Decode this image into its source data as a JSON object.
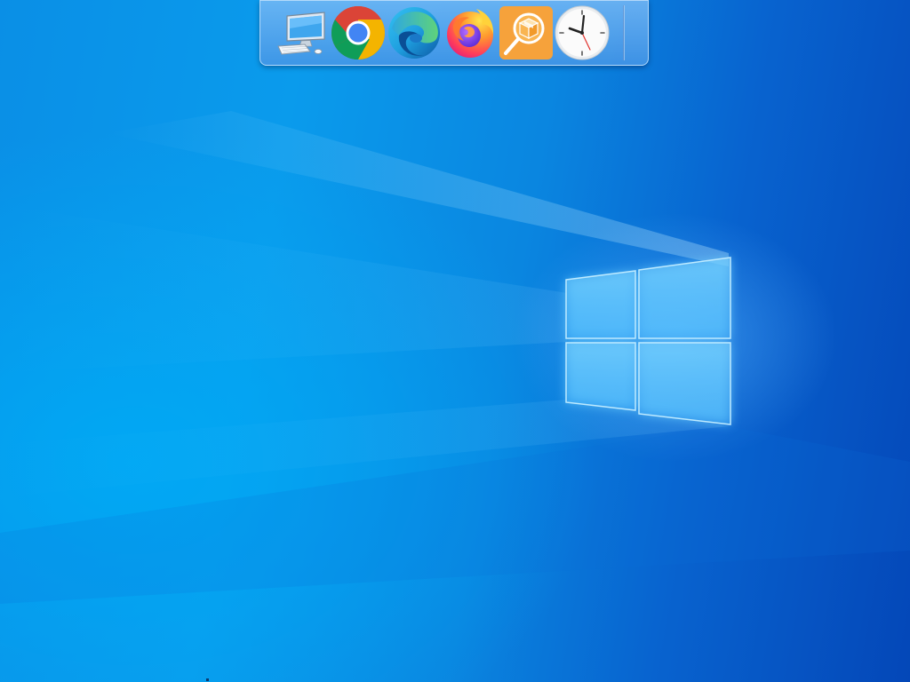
{
  "desktop": {
    "wallpaper": "windows-10-hero",
    "colors": {
      "sky": "#0a9bec",
      "deep": "#0447b8",
      "logo_glow": "#7fd0ff"
    }
  },
  "dock": {
    "items": [
      {
        "name": "this-pc",
        "icon": "computer-monitor-icon"
      },
      {
        "name": "chrome",
        "icon": "chrome-icon"
      },
      {
        "name": "edge",
        "icon": "edge-icon"
      },
      {
        "name": "firefox",
        "icon": "firefox-icon"
      },
      {
        "name": "package-explorer",
        "icon": "package-magnifier-icon"
      },
      {
        "name": "clock",
        "icon": "clock-icon"
      }
    ]
  }
}
